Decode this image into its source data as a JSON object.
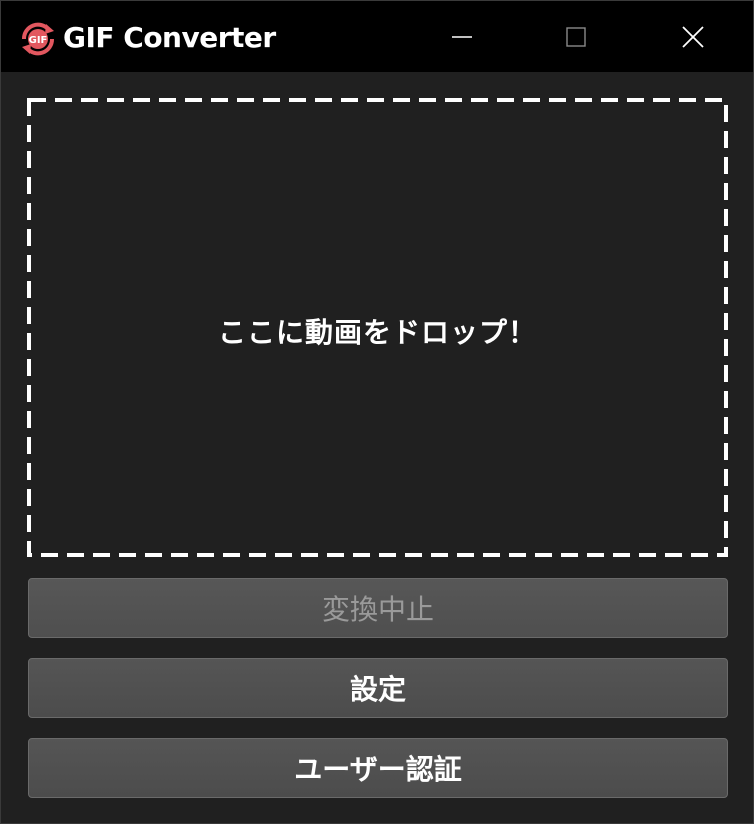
{
  "window": {
    "title": "GIF Converter",
    "icon": {
      "name": "gif-convert-icon",
      "label": "GIF",
      "color": "#e2575f"
    },
    "controls": {
      "minimize": "minimize-icon",
      "maximize": "maximize-icon",
      "close": "close-icon"
    }
  },
  "dropzone": {
    "text": "ここに動画をドロップ！"
  },
  "buttons": {
    "stop_label": "変換中止",
    "settings_label": "設定",
    "auth_label": "ユーザー認証"
  },
  "colors": {
    "titlebar": "#000000",
    "background": "#202020",
    "button": "#505050",
    "disabled_text": "#9a9a9a",
    "accent": "#e2575f"
  }
}
